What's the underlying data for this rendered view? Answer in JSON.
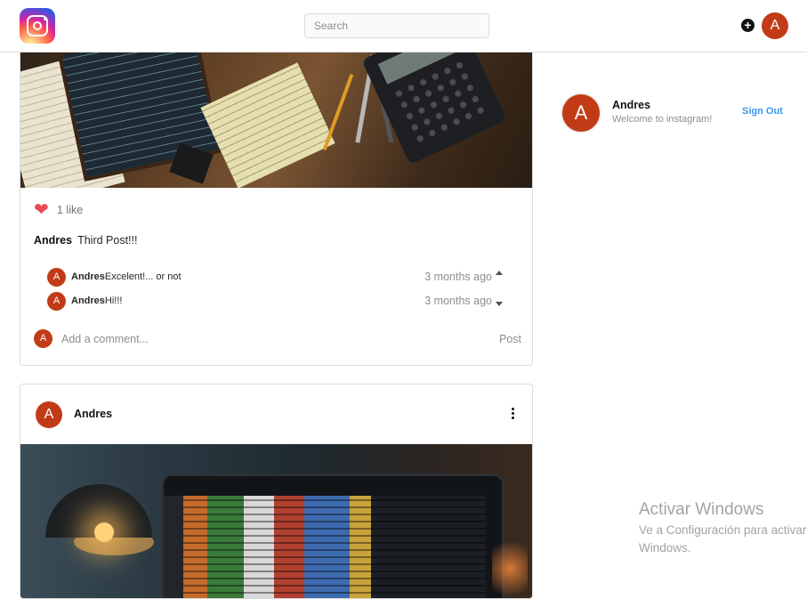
{
  "header": {
    "search_placeholder": "Search",
    "add_icon": "+",
    "user_initial": "A"
  },
  "post1": {
    "likes": "1 like",
    "username": "Andres",
    "caption": "Third Post!!!",
    "comments": [
      {
        "initial": "A",
        "user": "Andres",
        "text": "Excelent!... or not",
        "time": "3 months ago"
      },
      {
        "initial": "A",
        "user": "Andres",
        "text": "Hi!!!",
        "time": "3 months ago"
      }
    ],
    "comment_avatar_initial": "A",
    "comment_placeholder": "Add a comment...",
    "post_label": "Post"
  },
  "post2": {
    "initial": "A",
    "username": "Andres"
  },
  "sidebar": {
    "initial": "A",
    "username": "Andres",
    "subtitle": "Welcome to instagram!",
    "signout_label": "Sign Out"
  },
  "watermark": {
    "title": "Activar Windows",
    "line1": "Ve a Configuración para activar",
    "line2": "Windows."
  },
  "colors": {
    "avatar": "#c13b17",
    "link": "#3897f0",
    "like": "#ed4956"
  }
}
